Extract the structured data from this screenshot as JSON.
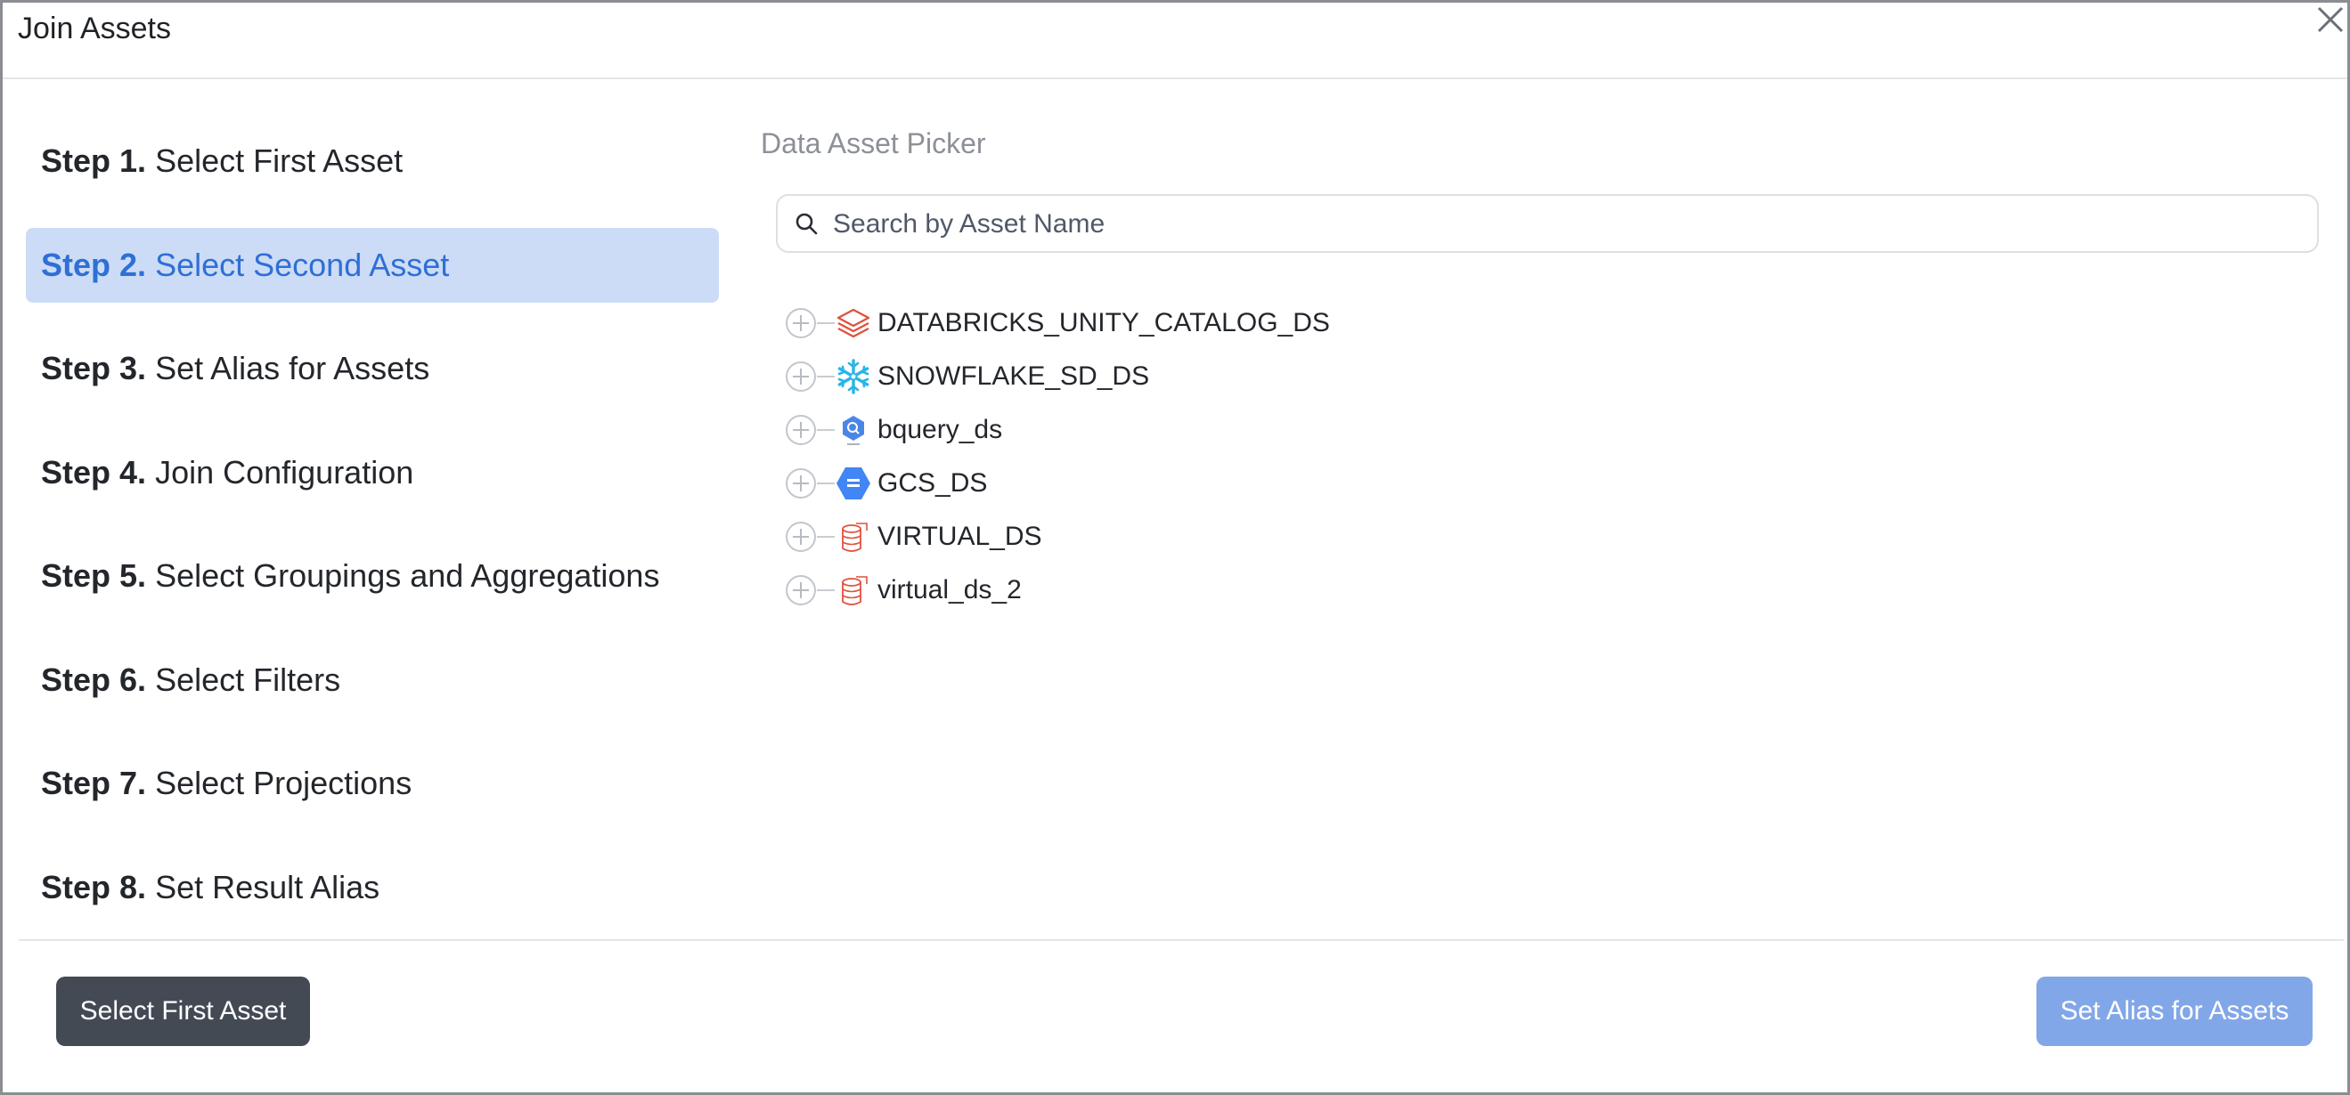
{
  "dialog": {
    "title": "Join Assets"
  },
  "steps": [
    {
      "num": "Step 1.",
      "label": "Select First Asset",
      "active": false
    },
    {
      "num": "Step 2.",
      "label": "Select Second Asset",
      "active": true
    },
    {
      "num": "Step 3.",
      "label": "Set Alias for Assets",
      "active": false
    },
    {
      "num": "Step 4.",
      "label": "Join Configuration",
      "active": false
    },
    {
      "num": "Step 5.",
      "label": "Select Groupings and Aggregations",
      "active": false
    },
    {
      "num": "Step 6.",
      "label": "Select Filters",
      "active": false
    },
    {
      "num": "Step 7.",
      "label": "Select Projections",
      "active": false
    },
    {
      "num": "Step 8.",
      "label": "Set Result Alias",
      "active": false
    }
  ],
  "picker": {
    "label": "Data Asset Picker",
    "search_placeholder": "Search by Asset Name"
  },
  "datasources": [
    {
      "name": "DATABRICKS_UNITY_CATALOG_DS",
      "icon": "databricks-icon"
    },
    {
      "name": "SNOWFLAKE_SD_DS",
      "icon": "snowflake-icon"
    },
    {
      "name": "bquery_ds",
      "icon": "bigquery-icon"
    },
    {
      "name": "GCS_DS",
      "icon": "gcs-icon"
    },
    {
      "name": "VIRTUAL_DS",
      "icon": "virtual-ds-icon"
    },
    {
      "name": "virtual_ds_2",
      "icon": "virtual-ds-icon"
    }
  ],
  "footer": {
    "back_label": "Select First Asset",
    "next_label": "Set Alias for Assets"
  },
  "colors": {
    "active_step_bg": "#ccdcf6",
    "active_step_text": "#2f6fd6",
    "dark_button": "#444a54",
    "primary_button": "#82a7e8"
  }
}
